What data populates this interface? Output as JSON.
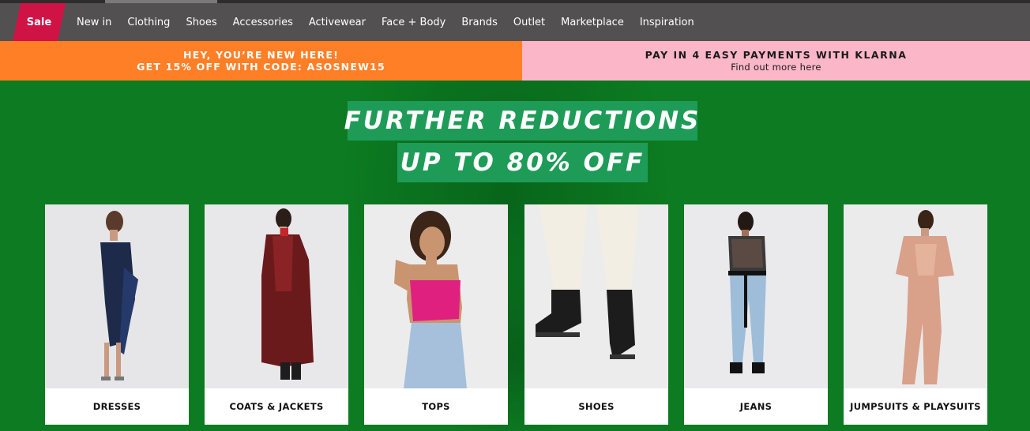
{
  "nav": {
    "sale": "Sale",
    "items": [
      "New in",
      "Clothing",
      "Shoes",
      "Accessories",
      "Activewear",
      "Face + Body",
      "Brands",
      "Outlet",
      "Marketplace",
      "Inspiration"
    ]
  },
  "promo": {
    "left_line1": "HEY, YOU’RE NEW HERE!",
    "left_line2": "GET 15% OFF WITH CODE: ASOSNEW15",
    "right_line1": "PAY IN 4 EASY PAYMENTS WITH KLARNA",
    "right_line2": "Find out more here"
  },
  "hero": {
    "headline1": "FURTHER REDUCTIONS",
    "headline2": "UP TO 80% OFF"
  },
  "categories": [
    "DRESSES",
    "COATS & JACKETS",
    "TOPS",
    "SHOES",
    "JEANS",
    "JUMPSUITS & PLAYSUITS"
  ],
  "colors": {
    "nav_bg": "#525050",
    "sale_bg": "#d01345",
    "promo_left_bg": "#ff7f27",
    "promo_right_bg": "#fbb6c8",
    "hero_bg": "#0c7b21",
    "headline_bg": "#1f9b58"
  }
}
